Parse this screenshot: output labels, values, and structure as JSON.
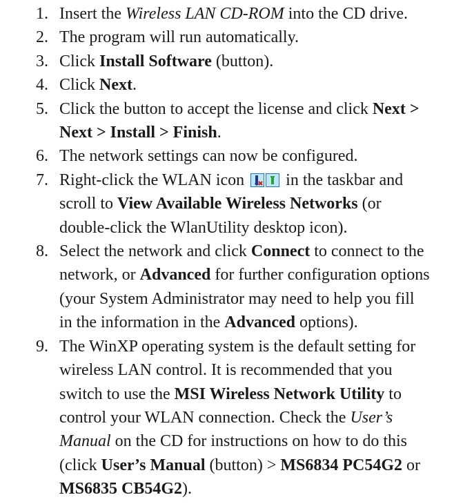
{
  "steps": [
    {
      "num": "1.",
      "lines": [
        [
          {
            "t": "Insert the "
          },
          {
            "t": "Wireless LAN CD-ROM",
            "s": "i"
          },
          {
            "t": " into the CD drive."
          }
        ]
      ]
    },
    {
      "num": "2.",
      "lines": [
        [
          {
            "t": "The program will run automatically."
          }
        ]
      ]
    },
    {
      "num": "3.",
      "lines": [
        [
          {
            "t": "Click "
          },
          {
            "t": "Install Software",
            "s": "b"
          },
          {
            "t": " (button)."
          }
        ]
      ]
    },
    {
      "num": "4.",
      "lines": [
        [
          {
            "t": "Click "
          },
          {
            "t": "Next",
            "s": "b"
          },
          {
            "t": "."
          }
        ]
      ]
    },
    {
      "num": "5.",
      "lines": [
        [
          {
            "t": "Click the button to accept the license and click "
          },
          {
            "t": "Next >",
            "s": "b"
          }
        ],
        [
          {
            "t": "Next > Install > Finish",
            "s": "b"
          },
          {
            "t": "."
          }
        ]
      ]
    },
    {
      "num": "6.",
      "lines": [
        [
          {
            "t": "The network settings can now be configured."
          }
        ]
      ]
    },
    {
      "num": "7.",
      "lines": [
        [
          {
            "t": "Right-click the WLAN icon "
          },
          {
            "icon": "wlan-taskbar-icons"
          },
          {
            "t": " in the taskbar and"
          }
        ],
        [
          {
            "t": "scroll to "
          },
          {
            "t": "View Available Wireless Networks",
            "s": "b"
          },
          {
            "t": " (or"
          }
        ],
        [
          {
            "t": "double-click the WlanUtility desktop icon)."
          }
        ]
      ]
    },
    {
      "num": "8.",
      "lines": [
        [
          {
            "t": "Select the network and click "
          },
          {
            "t": "Connect",
            "s": "b"
          },
          {
            "t": " to connect to the"
          }
        ],
        [
          {
            "t": "network, or "
          },
          {
            "t": "Advanced",
            "s": "b"
          },
          {
            "t": " for further configuration options"
          }
        ],
        [
          {
            "t": "(your System Administrator may need to help you fill"
          }
        ],
        [
          {
            "t": "in the information in the "
          },
          {
            "t": "Advanced",
            "s": "b"
          },
          {
            "t": " options)."
          }
        ]
      ]
    },
    {
      "num": "9.",
      "lines": [
        [
          {
            "t": "The WinXP operating system is the default setting for"
          }
        ],
        [
          {
            "t": "wireless LAN control. It is recommended that you"
          }
        ],
        [
          {
            "t": "switch to use the "
          },
          {
            "t": "MSI Wireless Network Utility",
            "s": "b"
          },
          {
            "t": " to"
          }
        ],
        [
          {
            "t": "control your WLAN connection. Check the "
          },
          {
            "t": "User’s",
            "s": "i"
          }
        ],
        [
          {
            "t": "Manual",
            "s": "i"
          },
          {
            "t": " on the CD for instructions on how to do this"
          }
        ],
        [
          {
            "t": "(click "
          },
          {
            "t": "User’s Manual",
            "s": "b"
          },
          {
            "t": " (button) > "
          },
          {
            "t": "MS6834 PC54G2",
            "s": "b"
          },
          {
            "t": " or"
          }
        ],
        [
          {
            "t": "MS6835 CB54G2",
            "s": "b"
          },
          {
            "t": ")."
          }
        ]
      ]
    }
  ]
}
